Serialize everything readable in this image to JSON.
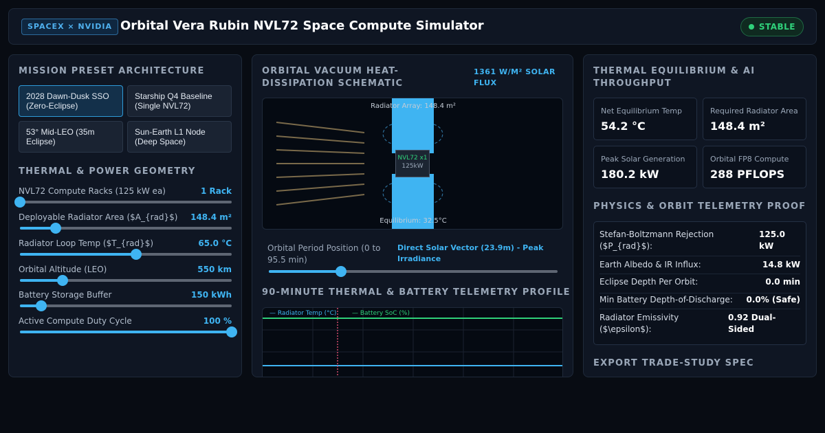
{
  "header": {
    "brand": "SPACEX × NVIDIA",
    "title": "Orbital Vera Rubin NVL72 Space Compute Simulator",
    "status": "STABLE"
  },
  "colors": {
    "accent": "#3fb4f2",
    "ok": "#2fd17a",
    "panel": "#0f1623",
    "background": "#080c13"
  },
  "presets": {
    "title": "MISSION PRESET ARCHITECTURE",
    "items": [
      {
        "label": "2028 Dawn-Dusk SSO (Zero-Eclipse)",
        "active": true
      },
      {
        "label": "Starship Q4 Baseline (Single NVL72)",
        "active": false
      },
      {
        "label": "53° Mid-LEO (35m Eclipse)",
        "active": false
      },
      {
        "label": "Sun-Earth L1 Node (Deep Space)",
        "active": false
      }
    ]
  },
  "geometry": {
    "title": "THERMAL & POWER GEOMETRY",
    "sliders": [
      {
        "label": "NVL72 Compute Racks (125 kW ea)",
        "value": "1 Rack",
        "fraction": 0.0
      },
      {
        "label": "Deployable Radiator Area ($A_{rad}$)",
        "value": "148.4 m²",
        "fraction": 0.17
      },
      {
        "label": "Radiator Loop Temp ($T_{rad}$)",
        "value": "65.0 °C",
        "fraction": 0.55
      },
      {
        "label": "Orbital Altitude (LEO)",
        "value": "550 km",
        "fraction": 0.2
      },
      {
        "label": "Battery Storage Buffer",
        "value": "150 kWh",
        "fraction": 0.1
      },
      {
        "label": "Active Compute Duty Cycle",
        "value": "100 %",
        "fraction": 1.0
      }
    ]
  },
  "schematic": {
    "title": "ORBITAL VACUUM HEAT-DISSIPATION SCHEMATIC",
    "flux": "1361 W/M² SOLAR FLUX",
    "radiator_label": "Radiator Array: 148.4 m²",
    "core_name": "NVL72 x1",
    "core_power": "125kW",
    "equilibrium_label": "Equilibrium: 32.5°C"
  },
  "orbit": {
    "label": "Orbital Period Position (0 to 95.5 min)",
    "vector": "Direct Solar Vector (23.9m) - Peak Irradiance",
    "fraction": 0.25
  },
  "telemetry": {
    "title": "90-MINUTE THERMAL & BATTERY TELEMETRY PROFILE",
    "legend_temp": "— Radiator Temp (°C)",
    "legend_soc": "— Battery SoC (%)"
  },
  "equilibrium": {
    "title": "THERMAL EQUILIBRIUM & AI THROUGHPUT",
    "cards": [
      {
        "label": "Net Equilibrium Temp",
        "value": "54.2 °C"
      },
      {
        "label": "Required Radiator Area",
        "value": "148.4 m²"
      },
      {
        "label": "Peak Solar Generation",
        "value": "180.2 kW"
      },
      {
        "label": "Orbital FP8 Compute",
        "value": "288 PFLOPS"
      }
    ]
  },
  "proof": {
    "title": "PHYSICS & ORBIT TELEMETRY PROOF",
    "rows": [
      {
        "label": "Stefan-Boltzmann Rejection ($P_{rad}$):",
        "value": "125.0 kW"
      },
      {
        "label": "Earth Albedo & IR Influx:",
        "value": "14.8 kW"
      },
      {
        "label": "Eclipse Depth Per Orbit:",
        "value": "0.0 min"
      },
      {
        "label": "Min Battery Depth-of-Discharge:",
        "value": "0.0% (Safe)"
      },
      {
        "label": "Radiator Emissivity ($\\epsilon$):",
        "value": "0.92 Dual-Sided"
      }
    ]
  },
  "export": {
    "title": "EXPORT TRADE-STUDY SPEC"
  }
}
